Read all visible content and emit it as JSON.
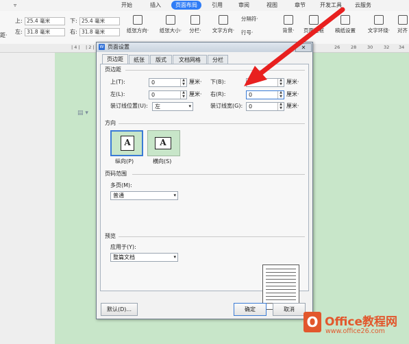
{
  "ribbon": {
    "tabs": [
      "开始",
      "插入",
      "页面布局",
      "引用",
      "审阅",
      "视图",
      "章节",
      "开发工具",
      "云服务"
    ],
    "active_tab": "页面布局",
    "margins": {
      "top_label": "上:",
      "top_value": "25.4 毫米",
      "bottom_label": "下:",
      "bottom_value": "25.4 毫米",
      "left_label": "左:",
      "left_value": "31.8 毫米",
      "right_label": "右:",
      "right_value": "31.8 毫米"
    },
    "left_cut_label": "距·",
    "tools": [
      "纸张方向·",
      "纸张大小·",
      "分栏·",
      "文字方向·",
      "分隔符·",
      "行号·",
      "背景·",
      "页面边框",
      "稿纸设置",
      "文字环绕·",
      "对齐"
    ]
  },
  "ruler": {
    "ticks": [
      "| 4 |",
      "| 2 |",
      "26",
      "28",
      "30",
      "32",
      "34"
    ]
  },
  "dialog": {
    "title": "页面设置",
    "close": "✕",
    "tabs": [
      "页边距",
      "纸张",
      "版式",
      "文档网格",
      "分栏"
    ],
    "active_tab": "页边距",
    "margins_group": "页边距",
    "fields": {
      "top_label": "上(T):",
      "top_value": "0",
      "bottom_label": "下(B):",
      "bottom_value": "0",
      "left_label": "左(L):",
      "left_value": "0",
      "right_label": "右(R):",
      "right_value": "0",
      "gutter_pos_label": "装订线位置(U):",
      "gutter_pos_value": "左",
      "gutter_label": "装订线宽(G):",
      "gutter_value": "0",
      "unit": "厘米·"
    },
    "orientation_group": "方向",
    "portrait_label": "纵向(P)",
    "landscape_label": "横向(S)",
    "orientation_glyph": "A",
    "page_range_group": "页码范围",
    "multi_page_label": "多页(M):",
    "multi_page_value": "普通",
    "preview_group": "预览",
    "apply_to_label": "应用于(Y):",
    "apply_to_value": "整篇文档",
    "default_button": "默认(D)...",
    "ok_button": "确定",
    "cancel_button": "取消"
  },
  "watermark": {
    "logo_letter": "O",
    "name": "Office教程网",
    "url": "www.office26.com"
  },
  "colors": {
    "accent": "#2f7cf6",
    "page_bg": "#c8e6c9",
    "arrow": "#e8201f",
    "logo": "#e2572c"
  }
}
